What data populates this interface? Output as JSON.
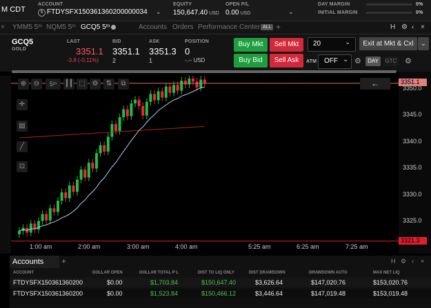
{
  "header": {
    "timezone": "M CDT",
    "account_label": "ACCOUNT",
    "account_id": "FTDYSFX150361360200000034",
    "equity_label": "EQUITY",
    "equity_value": "150,647.40",
    "equity_unit": "USD",
    "openpl_label": "OPEN P/L",
    "openpl_value": "0.00",
    "openpl_unit": "USD",
    "day_margin_label": "DAY MARGIN",
    "day_margin_value": "0%",
    "initial_margin_label": "INITIAL MARGIN",
    "initial_margin_value": "0%"
  },
  "tabs": [
    {
      "label": "YMM5 5ᵐ"
    },
    {
      "label": "NQM5 5ᵐ"
    },
    {
      "label": "GCQ5 5ᵐ"
    },
    {
      "label": "Accounts"
    },
    {
      "label": "Orders"
    },
    {
      "label": "Performance Center"
    }
  ],
  "tab_all": "ALL",
  "tab_right": "H",
  "quote": {
    "symbol": "GCQ5",
    "name": "GOLD",
    "last_label": "LAST",
    "last_value": "3351.1",
    "last_change": "-3.8 (-0.11%)",
    "bid_label": "BID",
    "bid_value": "3351.1",
    "bid_size": "2",
    "ask_label": "ASK",
    "ask_value": "3351.3",
    "ask_size": "1",
    "position_label": "POSITION",
    "position_value": "0",
    "position_pl": "-.-- USD"
  },
  "order": {
    "buy_mkt": "Buy Mkt",
    "sell_mkt": "Sell Mkt",
    "buy_bid": "Buy Bid",
    "sell_ask": "Sell Ask",
    "qty": "20",
    "exit": "Exit at Mkt & Cxl",
    "atm_label": "ATM",
    "atm_value": "OFF",
    "day": "DAY",
    "gtc": "GTC"
  },
  "chart_toolbar": {
    "interval": "5ᵐ"
  },
  "chart_data": {
    "type": "candlestick",
    "y_ticks": [
      "3350.0",
      "3345.0",
      "3340.0",
      "3335.0",
      "3330.0",
      "3325.0"
    ],
    "x_ticks": [
      "1:00 am",
      "2:00 am",
      "3:00 am",
      "4:00 am",
      "5:25 am",
      "6:25 am",
      "7:25 am"
    ],
    "ylim": [
      3320.5,
      3352.0
    ],
    "last_price_label": "3351.1",
    "low_price_label": "3321.3",
    "last_price": 3351.1,
    "low_price": 3321.3,
    "close_series": [
      3323.2,
      3323.8,
      3322.9,
      3324.6,
      3323.5,
      3325.1,
      3326.4,
      3325.2,
      3327.5,
      3326.8,
      3328.9,
      3330.5,
      3329.4,
      3331.8,
      3330.6,
      3332.9,
      3334.8,
      3333.3,
      3336.1,
      3335.0,
      3337.9,
      3339.4,
      3338.2,
      3341.0,
      3343.4,
      3342.1,
      3344.7,
      3346.2,
      3344.9,
      3347.3,
      3348.0,
      3346.8,
      3345.0,
      3347.6,
      3349.1,
      3347.9,
      3349.6,
      3348.4,
      3350.5,
      3349.3,
      3350.8,
      3349.7,
      3351.6,
      3350.9,
      3352.0,
      3351.4,
      3350.3,
      3351.8,
      3351.1
    ]
  },
  "accounts": {
    "title": "Accounts",
    "h_label": "H",
    "columns": [
      "ACCOUNT",
      "DOLLAR OPEN",
      "DOLLAR TOTAL P L",
      "DIST TO LIQ ONLY",
      "DIST DRAWDOWN",
      "DRAWDOWN AUTO",
      "MAX NET LIQ"
    ],
    "rows": [
      [
        "FTDYSFX150361360200",
        "$0.00",
        "$1,703.84",
        "$150,647.40",
        "$3,626.64",
        "$147,020.76",
        "$153,020.76"
      ],
      [
        "FTDYSFX150361360200",
        "$0.00",
        "$1,523.84",
        "$150,466.12",
        "$3,446.64",
        "$147,019.48",
        "$153,019.48"
      ]
    ]
  },
  "colors": {
    "up": "#1fbf45",
    "down": "#e8283c",
    "ma_fast": "#a8d4f0",
    "ma_slow": "#b02020"
  }
}
